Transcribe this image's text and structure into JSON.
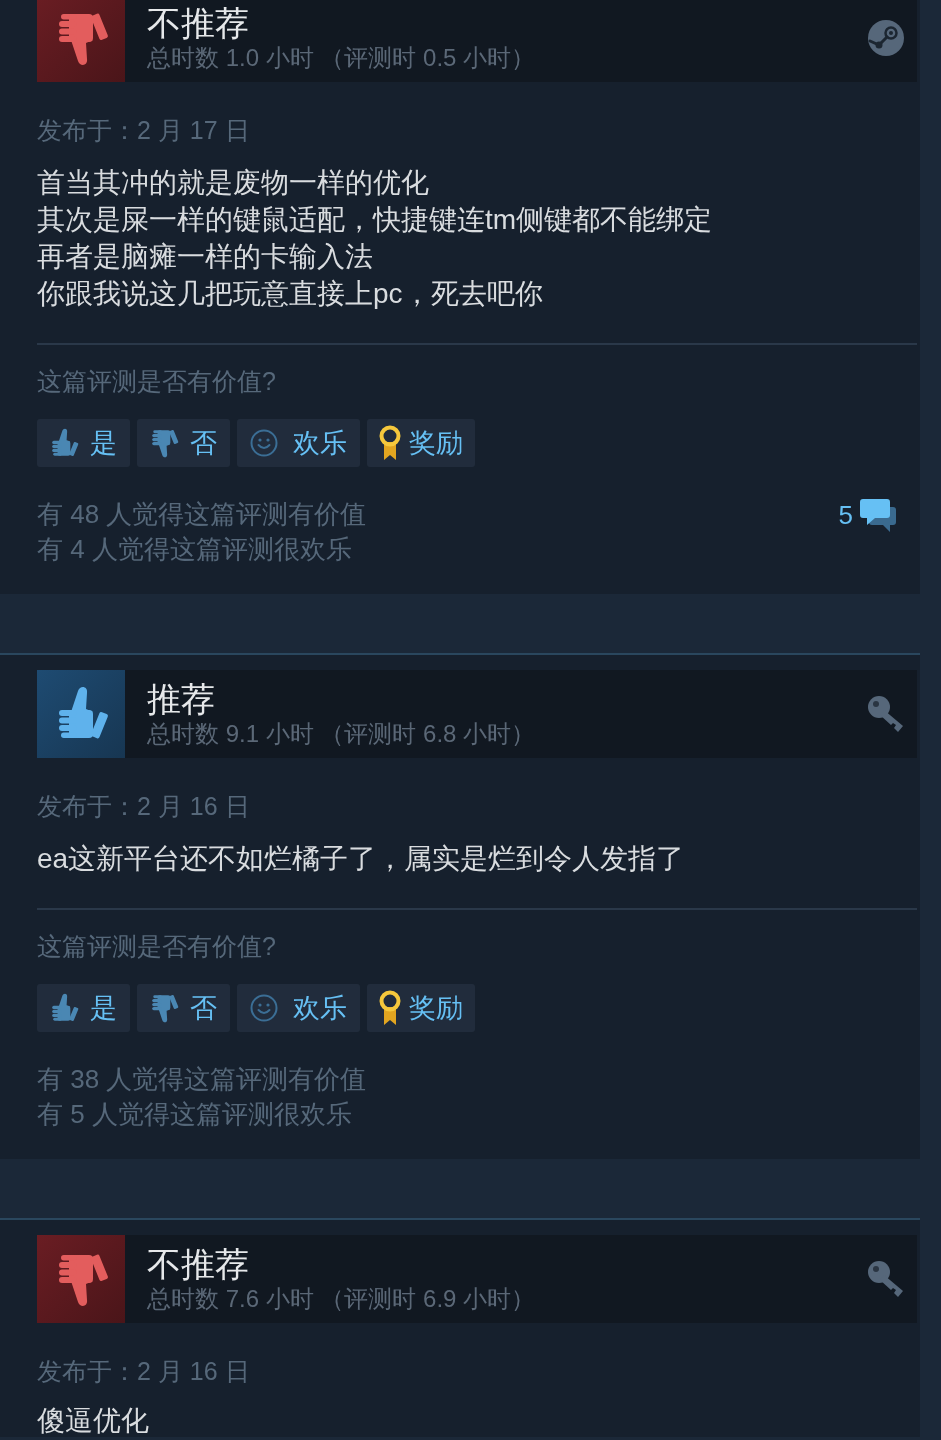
{
  "reviews": [
    {
      "recommended": false,
      "verdict": "不推荐",
      "playtime": "总时数 1.0 小时 （评测时 0.5 小时）",
      "key_activated": false,
      "posted": "发布于：2 月 17 日",
      "body_lines": [
        "首当其冲的就是废物一样的优化",
        "其次是屎一样的键鼠适配，快捷键连tm侧键都不能绑定",
        "再者是脑瘫一样的卡输入法",
        "你跟我说这几把玩意直接上pc，死去吧你"
      ],
      "helpful_prompt": "这篇评测是否有价值?",
      "vote_buttons": [
        {
          "kind": "yes",
          "label": "是"
        },
        {
          "kind": "no",
          "label": "否"
        },
        {
          "kind": "funny",
          "label": "欢乐"
        },
        {
          "kind": "award",
          "label": "奖励"
        }
      ],
      "vote_summary": [
        "有 48 人觉得这篇评测有价值",
        "有 4 人觉得这篇评测很欢乐"
      ],
      "comment_count": "5"
    },
    {
      "recommended": true,
      "verdict": "推荐",
      "playtime": "总时数 9.1 小时 （评测时 6.8 小时）",
      "key_activated": true,
      "posted": "发布于：2 月 16 日",
      "body_lines": [
        "ea这新平台还不如烂橘子了，属实是烂到令人发指了"
      ],
      "helpful_prompt": "这篇评测是否有价值?",
      "vote_buttons": [
        {
          "kind": "yes",
          "label": "是"
        },
        {
          "kind": "no",
          "label": "否"
        },
        {
          "kind": "funny",
          "label": "欢乐"
        },
        {
          "kind": "award",
          "label": "奖励"
        }
      ],
      "vote_summary": [
        "有 38 人觉得这篇评测有价值",
        "有 5 人觉得这篇评测很欢乐"
      ]
    },
    {
      "recommended": false,
      "verdict": "不推荐",
      "playtime": "总时数 7.6 小时 （评测时 6.9 小时）",
      "key_activated": true,
      "posted": "发布于：2 月 16 日",
      "body_lines": [
        "傻逼优化"
      ]
    }
  ]
}
